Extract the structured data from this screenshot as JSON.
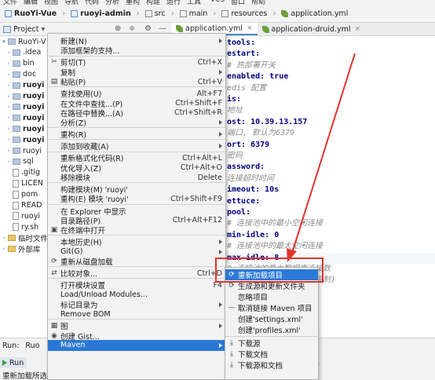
{
  "top_menubar": [
    "文件",
    "编辑",
    "视图",
    "导航",
    "代码",
    "分析",
    "重构",
    "构建",
    "运行",
    "工具",
    "VCS",
    "窗口",
    "帮助"
  ],
  "breadcrumb": {
    "items": [
      {
        "label": "RuoYi-Vue",
        "bold": true
      },
      {
        "label": "ruoyi-admin",
        "bold": true
      },
      {
        "label": "src"
      },
      {
        "label": "main"
      },
      {
        "label": "resources"
      },
      {
        "label": "application.yml"
      }
    ]
  },
  "project_toolbar": {
    "title": "Project",
    "dropdown": "▾",
    "icons": [
      "⊕",
      "≑",
      "⚙",
      "—"
    ]
  },
  "editor_tabs": [
    {
      "label": "application.yml",
      "active": true
    },
    {
      "label": "application-druid.yml",
      "active": false
    }
  ],
  "tree": {
    "items": [
      {
        "label": "RuoYi-V",
        "arrow": "▾",
        "indent": 0,
        "kind": "folder",
        "bold": false
      },
      {
        "label": ".idea",
        "arrow": "›",
        "indent": 1,
        "kind": "folder"
      },
      {
        "label": "bin",
        "arrow": "›",
        "indent": 1,
        "kind": "folder"
      },
      {
        "label": "doc",
        "arrow": "›",
        "indent": 1,
        "kind": "folder"
      },
      {
        "label": "ruoyi",
        "arrow": "›",
        "indent": 1,
        "kind": "folder",
        "bold": true
      },
      {
        "label": "ruoyi",
        "arrow": "›",
        "indent": 1,
        "kind": "folder",
        "bold": true
      },
      {
        "label": "ruoyi",
        "arrow": "›",
        "indent": 1,
        "kind": "folder",
        "bold": true
      },
      {
        "label": "ruoyi",
        "arrow": "›",
        "indent": 1,
        "kind": "folder",
        "bold": true
      },
      {
        "label": "ruoyi",
        "arrow": "›",
        "indent": 1,
        "kind": "folder",
        "bold": true
      },
      {
        "label": "ruoyi",
        "arrow": "›",
        "indent": 1,
        "kind": "folder",
        "bold": true
      },
      {
        "label": "ruoyi",
        "arrow": "›",
        "indent": 1,
        "kind": "folder"
      },
      {
        "label": "sql",
        "arrow": "›",
        "indent": 1,
        "kind": "folder"
      },
      {
        "label": ".gitig",
        "arrow": "",
        "indent": 1,
        "kind": "file"
      },
      {
        "label": "LICEN",
        "arrow": "",
        "indent": 1,
        "kind": "file"
      },
      {
        "label": "pom",
        "arrow": "",
        "indent": 1,
        "kind": "file"
      },
      {
        "label": "READ",
        "arrow": "",
        "indent": 1,
        "kind": "file"
      },
      {
        "label": "ruoyi",
        "arrow": "",
        "indent": 1,
        "kind": "file"
      },
      {
        "label": "ry.sh",
        "arrow": "",
        "indent": 1,
        "kind": "file"
      },
      {
        "label": "临时文件",
        "arrow": "›",
        "indent": 0,
        "kind": "folder"
      },
      {
        "label": "外部库",
        "arrow": "›",
        "indent": 0,
        "kind": "folder"
      }
    ]
  },
  "editor_lines": [
    {
      "t": "tools:",
      "cls": "k"
    },
    {
      "t": "estart:",
      "cls": "k"
    },
    {
      "t": "  # 热部署开关",
      "cls": "c"
    },
    {
      "t": "  enabled: true",
      "cls": "k"
    },
    {
      "t": "edis 配置",
      "cls": "c"
    },
    {
      "t": "is:",
      "cls": "k"
    },
    {
      "t": "  地址",
      "cls": "c"
    },
    {
      "t": "ost: 10.39.13.157",
      "cls": "k"
    },
    {
      "t": "  端口, 默认为6379",
      "cls": "c"
    },
    {
      "t": "ort: 6379",
      "cls": "k"
    },
    {
      "t": "  密码",
      "cls": "c"
    },
    {
      "t": "assword:",
      "cls": "k"
    },
    {
      "t": "  连接超时时间",
      "cls": "c"
    },
    {
      "t": "imeout: 10s",
      "cls": "k"
    },
    {
      "t": "ettuce:",
      "cls": "k"
    },
    {
      "t": "  pool:",
      "cls": "k"
    },
    {
      "t": "    # 连接池中的最小空闲连接",
      "cls": "c"
    },
    {
      "t": "    min-idle: 0",
      "cls": "k"
    },
    {
      "t": "    # 连接池中的最大空闲连接",
      "cls": "c"
    },
    {
      "t": "    max-idle: 8",
      "cls": "k"
    },
    {
      "t": "    # 连接池的最大数据库连接数",
      "cls": "c"
    },
    {
      "t": "              时间 (使用负值表示没有限制)",
      "cls": "c"
    }
  ],
  "context_menu": {
    "items": [
      {
        "label": "新建(N)",
        "arrow": true
      },
      {
        "label": "添加框架的支持..."
      },
      {
        "sep": true
      },
      {
        "label": "剪切(T)",
        "shortcut": "Ctrl+X",
        "icon": "✂"
      },
      {
        "label": "复制",
        "arrow": true
      },
      {
        "label": "粘贴(P)",
        "shortcut": "Ctrl+V",
        "icon": "▤"
      },
      {
        "sep": true
      },
      {
        "label": "查找使用(U)",
        "shortcut": "Alt+F7"
      },
      {
        "label": "在文件中查找...(P)",
        "shortcut": "Ctrl+Shift+F"
      },
      {
        "label": "在路径中替换...(A)",
        "shortcut": "Ctrl+Shift+R"
      },
      {
        "label": "分析(Z)",
        "arrow": true
      },
      {
        "sep": true
      },
      {
        "label": "重构(R)",
        "arrow": true
      },
      {
        "sep": true
      },
      {
        "label": "添加到收藏(A)",
        "arrow": true
      },
      {
        "sep": true
      },
      {
        "label": "重新格式化代码(R)",
        "shortcut": "Ctrl+Alt+L"
      },
      {
        "label": "优化导入(Z)",
        "shortcut": "Ctrl+Alt+O"
      },
      {
        "label": "移除模块",
        "shortcut": "Delete"
      },
      {
        "sep": true
      },
      {
        "label": "构建模块(M) 'ruoyi'"
      },
      {
        "label": "重构(E) 模块 'ruoyi'",
        "shortcut": "Ctrl+Shift+F9"
      },
      {
        "sep": true
      },
      {
        "label": "在 Explorer 中显示"
      },
      {
        "label": "目录路径(P)",
        "shortcut": "Ctrl+Alt+F12"
      },
      {
        "label": "在终端中打开",
        "icon": "▣"
      },
      {
        "sep": true
      },
      {
        "label": "本地历史(H)",
        "arrow": true
      },
      {
        "label": "Git(G)",
        "arrow": true
      },
      {
        "label": "重新从磁盘加载",
        "icon": "⟳"
      },
      {
        "sep": true
      },
      {
        "label": "比较对象...",
        "shortcut": "Ctrl+D",
        "icon": "⇄"
      },
      {
        "sep": true
      },
      {
        "label": "打开模块设置",
        "shortcut": "F4"
      },
      {
        "label": "Load/Unload Modules..."
      },
      {
        "label": "标记目录为",
        "arrow": true
      },
      {
        "label": "Remove BOM"
      },
      {
        "sep": true
      },
      {
        "label": "图",
        "arrow": true,
        "icon": "▦"
      },
      {
        "label": "创建 Gist...",
        "icon": "◉"
      },
      {
        "label": "Maven",
        "arrow": true,
        "selected": true
      }
    ]
  },
  "submenu_git": {
    "items": [
      {
        "label": "重新加载项目",
        "selected": true,
        "icon": "⟳"
      },
      {
        "label": "生成源和更新文件夹",
        "icon": "⟳"
      },
      {
        "label": "忽略项目"
      },
      {
        "label": "取消链接 Maven 项目",
        "icon": "—"
      },
      {
        "label": "创建'settings.xml'"
      },
      {
        "label": "创建'profiles.xml'"
      },
      {
        "sep": true
      },
      {
        "label": "下载源",
        "icon": "⤓"
      },
      {
        "label": "下载文档",
        "icon": "⤓"
      },
      {
        "label": "下载源和文档",
        "icon": "⤓"
      }
    ]
  },
  "bottom": {
    "run_header": "Run:",
    "run_item": "Ruo",
    "run_tab": "Run",
    "status": "重新加载所选",
    "right_text": "se"
  },
  "colors": {
    "annotation_red": "#e0352b",
    "selection_blue": "#2b79d6"
  }
}
